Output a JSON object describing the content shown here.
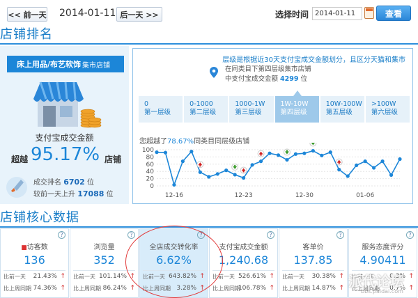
{
  "nav": {
    "prev_label": "<< 前一天",
    "current_date": "2014-01-11",
    "next_label": "后一天 >>",
    "select_time_label": "选择时间",
    "date_input_value": "2014-01-11",
    "search_label": "查看"
  },
  "section1_title": "店铺排名",
  "section2_title": "店铺核心数据",
  "left": {
    "category": "床上用品/布艺软饰",
    "category_sub": "集市店铺",
    "pay_label": "支付宝成交金额",
    "exceed_prefix": "超越",
    "exceed_pct": "95.17%",
    "exceed_suffix": "店铺",
    "rank_prefix": "成交排名",
    "rank_value": "6702",
    "rank_unit": "位",
    "change_prefix": "较前一天上升",
    "change_value": "17088",
    "change_unit": "位"
  },
  "right": {
    "tier_note": "层级是根据近30天支付宝成交金额划分，且区分天猫和集市",
    "tier_info_line1": "在同类目下第四层级集市店铺",
    "tier_info_line2_prefix": "中支付宝成交金额",
    "tier_info_rank": "4299",
    "tier_info_unit": "位",
    "tiers": [
      {
        "range": "0",
        "name": "第一层级"
      },
      {
        "range": "0-1000",
        "name": "第二层级"
      },
      {
        "range": "1000-1W",
        "name": "第三层级"
      },
      {
        "range": "1W-10W",
        "name": "第四层级"
      },
      {
        "range": "10W-100W",
        "name": "第五层级"
      },
      {
        "range": ">100W",
        "name": "第六层级"
      }
    ],
    "chart_caption_prefix": "您超越了",
    "chart_caption_pct": "78.67%",
    "chart_caption_suffix": "同类目同层级店铺"
  },
  "chart_data": {
    "type": "line",
    "x_ticks": [
      "12-16",
      "12-23",
      "12-30",
      "01-06"
    ],
    "y_ticks": [
      100,
      80,
      60,
      40,
      20,
      0
    ],
    "ylim": [
      0,
      100
    ],
    "values": [
      93,
      92,
      3,
      68,
      95,
      38,
      25,
      33,
      43,
      31,
      22,
      58,
      68,
      90,
      85,
      72,
      88,
      90,
      97,
      84,
      93,
      45,
      27,
      57,
      68,
      50,
      68,
      30,
      74
    ],
    "markers": [
      {
        "index": 5,
        "dir": "up"
      },
      {
        "index": 9,
        "dir": "down"
      },
      {
        "index": 10,
        "dir": "up"
      },
      {
        "index": 12,
        "dir": "up"
      },
      {
        "index": 15,
        "dir": "down"
      },
      {
        "index": 18,
        "dir": "down"
      },
      {
        "index": 21,
        "dir": "up"
      }
    ],
    "colors": {
      "line": "#1c86d8",
      "up": "#d02020",
      "down": "#3a9a2a"
    }
  },
  "metrics": [
    {
      "title": "访客数",
      "value": "136",
      "row1_label": "比前一天",
      "row1_value": "21.43%",
      "row2_label": "比上周同期",
      "row2_value": "74.36%"
    },
    {
      "title": "浏览量",
      "value": "352",
      "row1_label": "比前一天",
      "row1_value": "101.14%",
      "row2_label": "比上周同期",
      "row2_value": "86.24%"
    },
    {
      "title": "全店成交转化率",
      "value": "6.62%",
      "row1_label": "比前一天",
      "row1_value": "643.82%",
      "row2_label": "比上周同期",
      "row2_value": "3.28%"
    },
    {
      "title": "支付宝成交金额",
      "value": "1,240.68",
      "row1_label": "比前一天",
      "row1_value": "526.61%",
      "row2_label": "比上周同期",
      "row2_value": "106.78%"
    },
    {
      "title": "客单价",
      "value": "137.85",
      "row1_label": "比前一天",
      "row1_value": "30.38%",
      "row2_label": "比上周同期",
      "row2_value": "14.87%"
    },
    {
      "title": "服务态度评分",
      "value": "4.90411",
      "row1_label": "比前一天",
      "row1_value": "0.3%",
      "row2_label": "比上周同期",
      "row2_value": "0.7%"
    }
  ],
  "help_glyph": "?",
  "up_arrow": "↑",
  "watermark": "派代论坛",
  "watermark_url": "bbs.paidai.com"
}
